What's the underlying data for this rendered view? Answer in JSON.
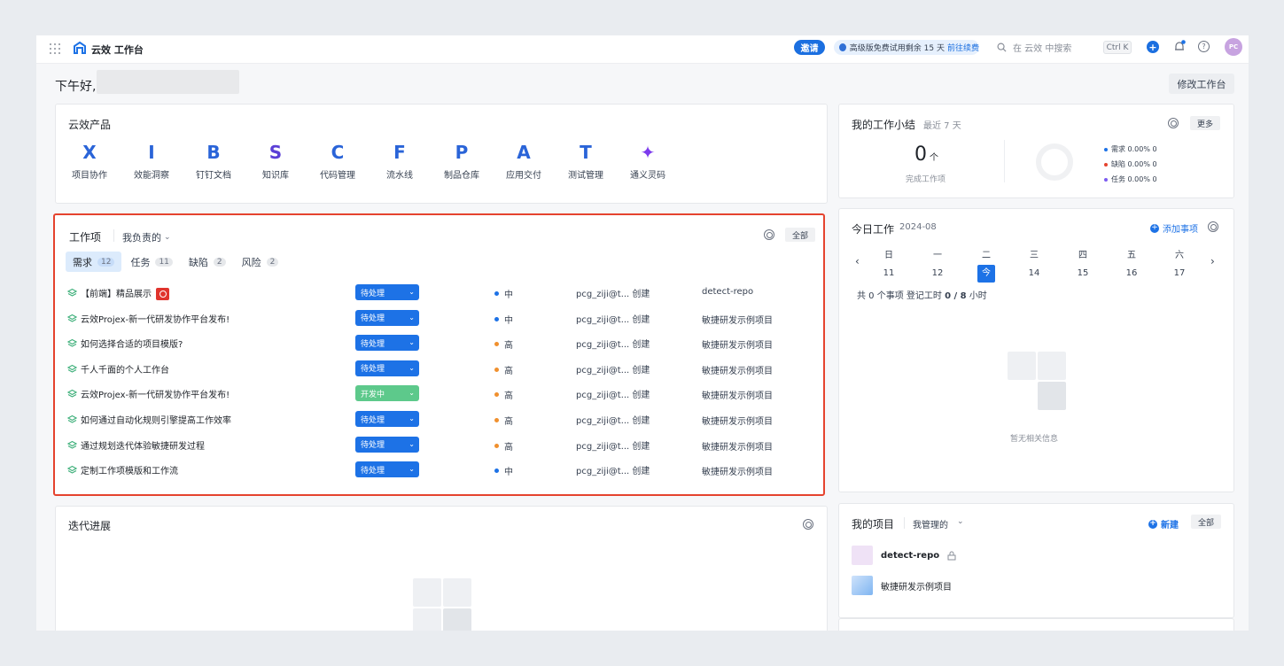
{
  "header": {
    "app_title": "云效 工作台",
    "invite_label": "邀请",
    "trial_text": "高级版免费试用剩余 15 天",
    "trial_link": "前往续费",
    "search_placeholder": "在 云效 中搜索",
    "shortcut": "Ctrl K",
    "avatar_initials": "PC",
    "icons": [
      "apps-grid-icon",
      "logo-icon",
      "clock-icon",
      "search-icon",
      "plus-icon",
      "bell-icon",
      "help-icon"
    ]
  },
  "greeting": "下午好,",
  "edit_workbench_label": "修改工作台",
  "products": {
    "title": "云效产品",
    "items": [
      {
        "label": "项目协作",
        "glyph": "X",
        "color": "#2a64d8"
      },
      {
        "label": "效能洞察",
        "glyph": "I",
        "color": "#2a64d8"
      },
      {
        "label": "钉钉文档",
        "glyph": "B",
        "color": "#2a64d8"
      },
      {
        "label": "知识库",
        "glyph": "S",
        "color": "#5b3fd6"
      },
      {
        "label": "代码管理",
        "glyph": "C",
        "color": "#2a64d8"
      },
      {
        "label": "流水线",
        "glyph": "F",
        "color": "#2a64d8"
      },
      {
        "label": "制品仓库",
        "glyph": "P",
        "color": "#2a64d8"
      },
      {
        "label": "应用交付",
        "glyph": "A",
        "color": "#2a64d8"
      },
      {
        "label": "测试管理",
        "glyph": "T",
        "color": "#2a64d8"
      },
      {
        "label": "通义灵码",
        "glyph": "✦",
        "color": "#7c3aed"
      }
    ]
  },
  "workitems": {
    "title": "工作项",
    "filter": "我负责的",
    "all_label": "全部",
    "tabs": [
      {
        "label": "需求",
        "count": "12"
      },
      {
        "label": "任务",
        "count": "11"
      },
      {
        "label": "缺陷",
        "count": "2"
      },
      {
        "label": "风险",
        "count": "2"
      }
    ],
    "rows": [
      {
        "name": "【前端】精品展示",
        "status": "待处理",
        "priority": "中",
        "creator": "pcg_ziji@t...",
        "action": "创建",
        "project": "detect-repo",
        "alarm": true
      },
      {
        "name": "云效Projex-新一代研发协作平台发布!",
        "status": "待处理",
        "priority": "中",
        "creator": "pcg_ziji@t...",
        "action": "创建",
        "project": "敏捷研发示例项目"
      },
      {
        "name": "如何选择合适的项目模版?",
        "status": "待处理",
        "priority": "高",
        "creator": "pcg_ziji@t...",
        "action": "创建",
        "project": "敏捷研发示例项目"
      },
      {
        "name": "千人千面的个人工作台",
        "status": "待处理",
        "priority": "高",
        "creator": "pcg_ziji@t...",
        "action": "创建",
        "project": "敏捷研发示例项目"
      },
      {
        "name": "云效Projex-新一代研发协作平台发布!",
        "status": "开发中",
        "priority": "高",
        "creator": "pcg_ziji@t...",
        "action": "创建",
        "project": "敏捷研发示例项目"
      },
      {
        "name": "如何通过自动化规则引擎提高工作效率",
        "status": "待处理",
        "priority": "高",
        "creator": "pcg_ziji@t...",
        "action": "创建",
        "project": "敏捷研发示例项目"
      },
      {
        "name": "通过规划迭代体验敏捷研发过程",
        "status": "待处理",
        "priority": "高",
        "creator": "pcg_ziji@t...",
        "action": "创建",
        "project": "敏捷研发示例项目"
      },
      {
        "name": "定制工作项模版和工作流",
        "status": "待处理",
        "priority": "中",
        "creator": "pcg_ziji@t...",
        "action": "创建",
        "project": "敏捷研发示例项目"
      }
    ],
    "colors": {
      "high": "#f0902e",
      "medium": "#1d72e6",
      "pending": "#1d72e6",
      "developing": "#5dc98b"
    }
  },
  "iteration": {
    "title": "迭代进展"
  },
  "summary": {
    "title": "我的工作小结",
    "range": "最近 7 天",
    "more_label": "更多",
    "count": "0",
    "unit": "个",
    "done_label": "完成工作项",
    "legend": [
      {
        "label": "需求 0.00% 0",
        "color": "#1d72e6"
      },
      {
        "label": "缺陷 0.00% 0",
        "color": "#e5432e"
      },
      {
        "label": "任务 0.00% 0",
        "color": "#7c5cf0"
      }
    ]
  },
  "today": {
    "title": "今日工作",
    "month": "2024-08",
    "add_label": "添加事项",
    "weekdays": [
      "日",
      "一",
      "二",
      "三",
      "四",
      "五",
      "六"
    ],
    "days": [
      "11",
      "12",
      "今",
      "14",
      "15",
      "16",
      "17"
    ],
    "summary_prefix": "共 0 个事项  登记工时",
    "hours": "0 / 8",
    "hours_unit": "小时",
    "empty_text": "暂无相关信息"
  },
  "projects": {
    "title": "我的项目",
    "filter": "我管理的",
    "new_label": "新建",
    "all_label": "全部",
    "items": [
      {
        "name": "detect-repo"
      },
      {
        "name": "敏捷研发示例项目"
      }
    ]
  }
}
